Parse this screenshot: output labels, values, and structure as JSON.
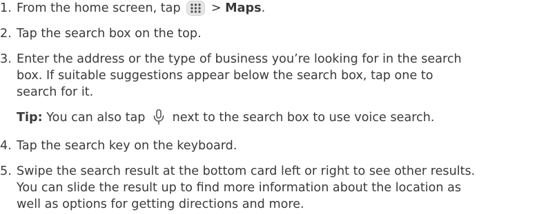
{
  "steps": [
    {
      "number": "1.",
      "pre": "From the home screen, tap",
      "icon": "apps-grid-icon",
      "sep": ">",
      "target": "Maps",
      "post": "."
    },
    {
      "number": "2.",
      "text": "Tap the search box on the top."
    },
    {
      "number": "3.",
      "lines": [
        "Enter the address or the type of business you’re looking for in the search",
        "box. If suitable suggestions appear below the search box, tap one to",
        "search for it."
      ],
      "tip": {
        "label": "Tip:",
        "pre": "You can also tap",
        "icon": "microphone-icon",
        "post": "next to the search box to use voice search."
      }
    },
    {
      "number": "4.",
      "text": "Tap the search key on the keyboard."
    },
    {
      "number": "5.",
      "lines": [
        "Swipe the search result at the bottom card left or right to see other results.",
        "You can slide the result up to find more information about the location as",
        "well as options for getting directions and more."
      ]
    }
  ],
  "colors": {
    "text": "#3a3a3a",
    "icon_background": "#e6e6e6",
    "icon_dots": "#555555"
  }
}
